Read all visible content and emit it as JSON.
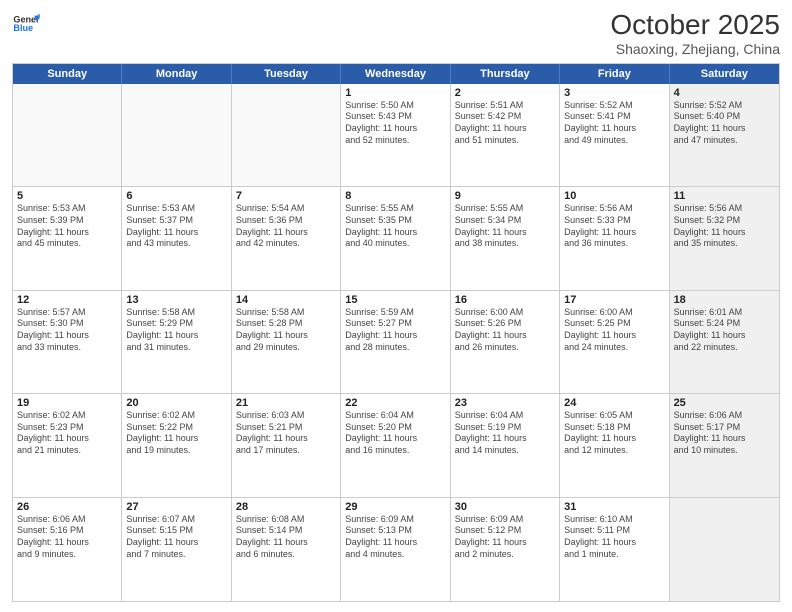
{
  "logo": {
    "line1": "General",
    "line2": "Blue"
  },
  "title": "October 2025",
  "location": "Shaoxing, Zhejiang, China",
  "dayHeaders": [
    "Sunday",
    "Monday",
    "Tuesday",
    "Wednesday",
    "Thursday",
    "Friday",
    "Saturday"
  ],
  "weeks": [
    [
      {
        "day": "",
        "info": "",
        "empty": true
      },
      {
        "day": "",
        "info": "",
        "empty": true
      },
      {
        "day": "",
        "info": "",
        "empty": true
      },
      {
        "day": "1",
        "info": "Sunrise: 5:50 AM\nSunset: 5:43 PM\nDaylight: 11 hours\nand 52 minutes."
      },
      {
        "day": "2",
        "info": "Sunrise: 5:51 AM\nSunset: 5:42 PM\nDaylight: 11 hours\nand 51 minutes."
      },
      {
        "day": "3",
        "info": "Sunrise: 5:52 AM\nSunset: 5:41 PM\nDaylight: 11 hours\nand 49 minutes."
      },
      {
        "day": "4",
        "info": "Sunrise: 5:52 AM\nSunset: 5:40 PM\nDaylight: 11 hours\nand 47 minutes.",
        "shaded": true
      }
    ],
    [
      {
        "day": "5",
        "info": "Sunrise: 5:53 AM\nSunset: 5:39 PM\nDaylight: 11 hours\nand 45 minutes."
      },
      {
        "day": "6",
        "info": "Sunrise: 5:53 AM\nSunset: 5:37 PM\nDaylight: 11 hours\nand 43 minutes."
      },
      {
        "day": "7",
        "info": "Sunrise: 5:54 AM\nSunset: 5:36 PM\nDaylight: 11 hours\nand 42 minutes."
      },
      {
        "day": "8",
        "info": "Sunrise: 5:55 AM\nSunset: 5:35 PM\nDaylight: 11 hours\nand 40 minutes."
      },
      {
        "day": "9",
        "info": "Sunrise: 5:55 AM\nSunset: 5:34 PM\nDaylight: 11 hours\nand 38 minutes."
      },
      {
        "day": "10",
        "info": "Sunrise: 5:56 AM\nSunset: 5:33 PM\nDaylight: 11 hours\nand 36 minutes."
      },
      {
        "day": "11",
        "info": "Sunrise: 5:56 AM\nSunset: 5:32 PM\nDaylight: 11 hours\nand 35 minutes.",
        "shaded": true
      }
    ],
    [
      {
        "day": "12",
        "info": "Sunrise: 5:57 AM\nSunset: 5:30 PM\nDaylight: 11 hours\nand 33 minutes."
      },
      {
        "day": "13",
        "info": "Sunrise: 5:58 AM\nSunset: 5:29 PM\nDaylight: 11 hours\nand 31 minutes."
      },
      {
        "day": "14",
        "info": "Sunrise: 5:58 AM\nSunset: 5:28 PM\nDaylight: 11 hours\nand 29 minutes."
      },
      {
        "day": "15",
        "info": "Sunrise: 5:59 AM\nSunset: 5:27 PM\nDaylight: 11 hours\nand 28 minutes."
      },
      {
        "day": "16",
        "info": "Sunrise: 6:00 AM\nSunset: 5:26 PM\nDaylight: 11 hours\nand 26 minutes."
      },
      {
        "day": "17",
        "info": "Sunrise: 6:00 AM\nSunset: 5:25 PM\nDaylight: 11 hours\nand 24 minutes."
      },
      {
        "day": "18",
        "info": "Sunrise: 6:01 AM\nSunset: 5:24 PM\nDaylight: 11 hours\nand 22 minutes.",
        "shaded": true
      }
    ],
    [
      {
        "day": "19",
        "info": "Sunrise: 6:02 AM\nSunset: 5:23 PM\nDaylight: 11 hours\nand 21 minutes."
      },
      {
        "day": "20",
        "info": "Sunrise: 6:02 AM\nSunset: 5:22 PM\nDaylight: 11 hours\nand 19 minutes."
      },
      {
        "day": "21",
        "info": "Sunrise: 6:03 AM\nSunset: 5:21 PM\nDaylight: 11 hours\nand 17 minutes."
      },
      {
        "day": "22",
        "info": "Sunrise: 6:04 AM\nSunset: 5:20 PM\nDaylight: 11 hours\nand 16 minutes."
      },
      {
        "day": "23",
        "info": "Sunrise: 6:04 AM\nSunset: 5:19 PM\nDaylight: 11 hours\nand 14 minutes."
      },
      {
        "day": "24",
        "info": "Sunrise: 6:05 AM\nSunset: 5:18 PM\nDaylight: 11 hours\nand 12 minutes."
      },
      {
        "day": "25",
        "info": "Sunrise: 6:06 AM\nSunset: 5:17 PM\nDaylight: 11 hours\nand 10 minutes.",
        "shaded": true
      }
    ],
    [
      {
        "day": "26",
        "info": "Sunrise: 6:06 AM\nSunset: 5:16 PM\nDaylight: 11 hours\nand 9 minutes."
      },
      {
        "day": "27",
        "info": "Sunrise: 6:07 AM\nSunset: 5:15 PM\nDaylight: 11 hours\nand 7 minutes."
      },
      {
        "day": "28",
        "info": "Sunrise: 6:08 AM\nSunset: 5:14 PM\nDaylight: 11 hours\nand 6 minutes."
      },
      {
        "day": "29",
        "info": "Sunrise: 6:09 AM\nSunset: 5:13 PM\nDaylight: 11 hours\nand 4 minutes."
      },
      {
        "day": "30",
        "info": "Sunrise: 6:09 AM\nSunset: 5:12 PM\nDaylight: 11 hours\nand 2 minutes."
      },
      {
        "day": "31",
        "info": "Sunrise: 6:10 AM\nSunset: 5:11 PM\nDaylight: 11 hours\nand 1 minute."
      },
      {
        "day": "",
        "info": "",
        "empty": true,
        "shaded": true
      }
    ]
  ]
}
